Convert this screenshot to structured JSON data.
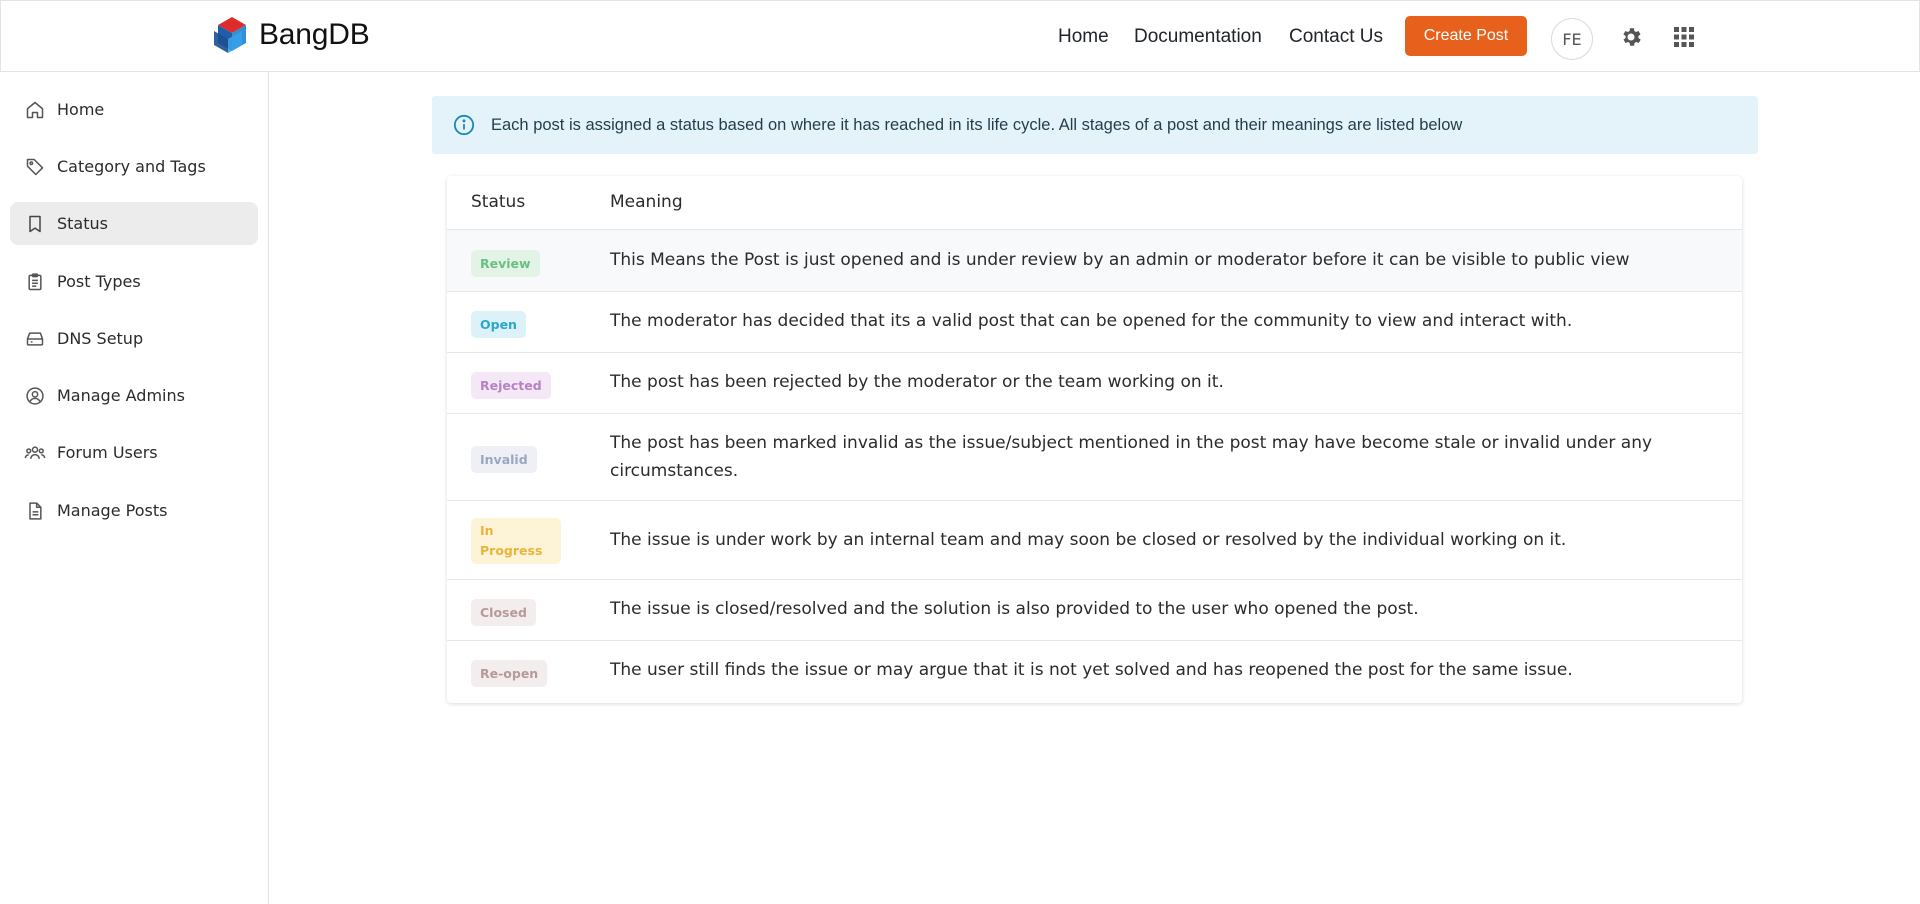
{
  "app": {
    "brand": "BangDB"
  },
  "header": {
    "nav": [
      "Home",
      "Documentation",
      "Contact Us"
    ],
    "create_button": "Create Post",
    "avatar_initials": "FE",
    "accent_color": "#e8611c"
  },
  "sidebar": {
    "items": [
      {
        "label": "Home",
        "icon": "home-icon"
      },
      {
        "label": "Category and Tags",
        "icon": "tag-icon"
      },
      {
        "label": "Status",
        "icon": "bookmark-icon",
        "active": true
      },
      {
        "label": "Post Types",
        "icon": "clipboard-icon"
      },
      {
        "label": "DNS Setup",
        "icon": "server-icon"
      },
      {
        "label": "Manage Admins",
        "icon": "user-circle-icon"
      },
      {
        "label": "Forum Users",
        "icon": "users-icon"
      },
      {
        "label": "Manage Posts",
        "icon": "document-icon"
      }
    ]
  },
  "info": {
    "text": "Each post is assigned a status based on where it has reached in its life cycle. All stages of a post and their meanings are listed below"
  },
  "table": {
    "headers": [
      "Status",
      "Meaning"
    ],
    "rows": [
      {
        "status": "Review",
        "meaning": "This Means the Post is just opened and is under review by an admin or moderator before it can be visible to public view",
        "color": "#6bbf82",
        "bg": "#e3f4e6"
      },
      {
        "status": "Open",
        "meaning": "The moderator has decided that its a valid post that can be opened for the community to view and interact with.",
        "color": "#2aa7c9",
        "bg": "#dcf2f8"
      },
      {
        "status": "Rejected",
        "meaning": "The post has been rejected by the moderator or the team working on it.",
        "color": "#b583c2",
        "bg": "#f5e8f6"
      },
      {
        "status": "Invalid",
        "meaning": "The post has been marked invalid as the issue/subject mentioned in the post may have become stale or invalid under any circumstances.",
        "color": "#9aa6c4",
        "bg": "#eef0f6"
      },
      {
        "status": "In Progress",
        "meaning": "The issue is under work by an internal team and may soon be closed or resolved by the individual working on it.",
        "color": "#e8b43c",
        "bg": "#fdf4d8"
      },
      {
        "status": "Closed",
        "meaning": "The issue is closed/resolved and the solution is also provided to the user who opened the post.",
        "color": "#b59a9a",
        "bg": "#f4eded"
      },
      {
        "status": "Re-open",
        "meaning": "The user still finds the issue or may argue that it is not yet solved and has reopened the post for the same issue.",
        "color": "#b59a9a",
        "bg": "#f4eded"
      }
    ]
  }
}
